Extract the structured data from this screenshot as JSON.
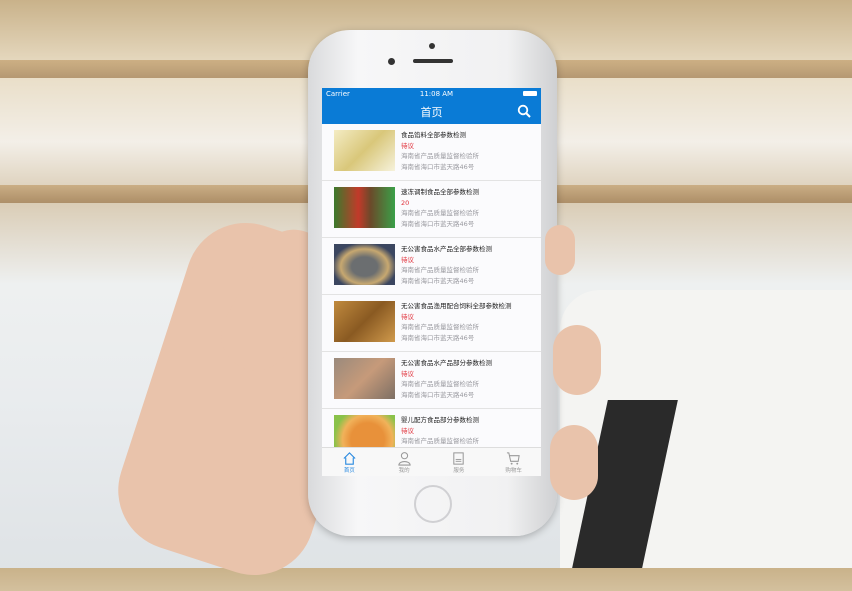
{
  "status_bar": {
    "carrier": "Carrier",
    "time": "11:08 AM"
  },
  "nav": {
    "title": "首页",
    "search_icon": "search-icon"
  },
  "accent": "#0a7bd6",
  "price_color": "#e0303a",
  "items": [
    {
      "title": "食品馅料全部参数检测",
      "price": "待议",
      "org": "海南省产品质量监督检验所",
      "address": "海南省海口市蓝天路46号",
      "image": "crackers"
    },
    {
      "title": "速冻调制食品全部参数检测",
      "price": "20",
      "org": "海南省产品质量监督检验所",
      "address": "海南省海口市蓝天路46号",
      "image": "packaged-foods"
    },
    {
      "title": "无公害食品水产品全部参数检测",
      "price": "待议",
      "org": "海南省产品质量监督检验所",
      "address": "海南省海口市蓝天路46号",
      "image": "fish"
    },
    {
      "title": "无公害食品渔用配合饲料全部参数检测",
      "price": "待议",
      "org": "海南省产品质量监督检验所",
      "address": "海南省海口市蓝天路46号",
      "image": "feed"
    },
    {
      "title": "无公害食品水产品部分参数检测",
      "price": "待议",
      "org": "海南省产品质量监督检验所",
      "address": "海南省海口市蓝天路46号",
      "image": "shrimp"
    },
    {
      "title": "婴儿配方食品部分参数检测",
      "price": "待议",
      "org": "海南省产品质量监督检验所",
      "address": "",
      "image": "baby-food"
    }
  ],
  "tabs": [
    {
      "label": "首页",
      "icon": "home-icon",
      "active": true
    },
    {
      "label": "我的",
      "icon": "user-icon",
      "active": false
    },
    {
      "label": "服务",
      "icon": "document-icon",
      "active": false
    },
    {
      "label": "购物车",
      "icon": "cart-icon",
      "active": false
    }
  ]
}
